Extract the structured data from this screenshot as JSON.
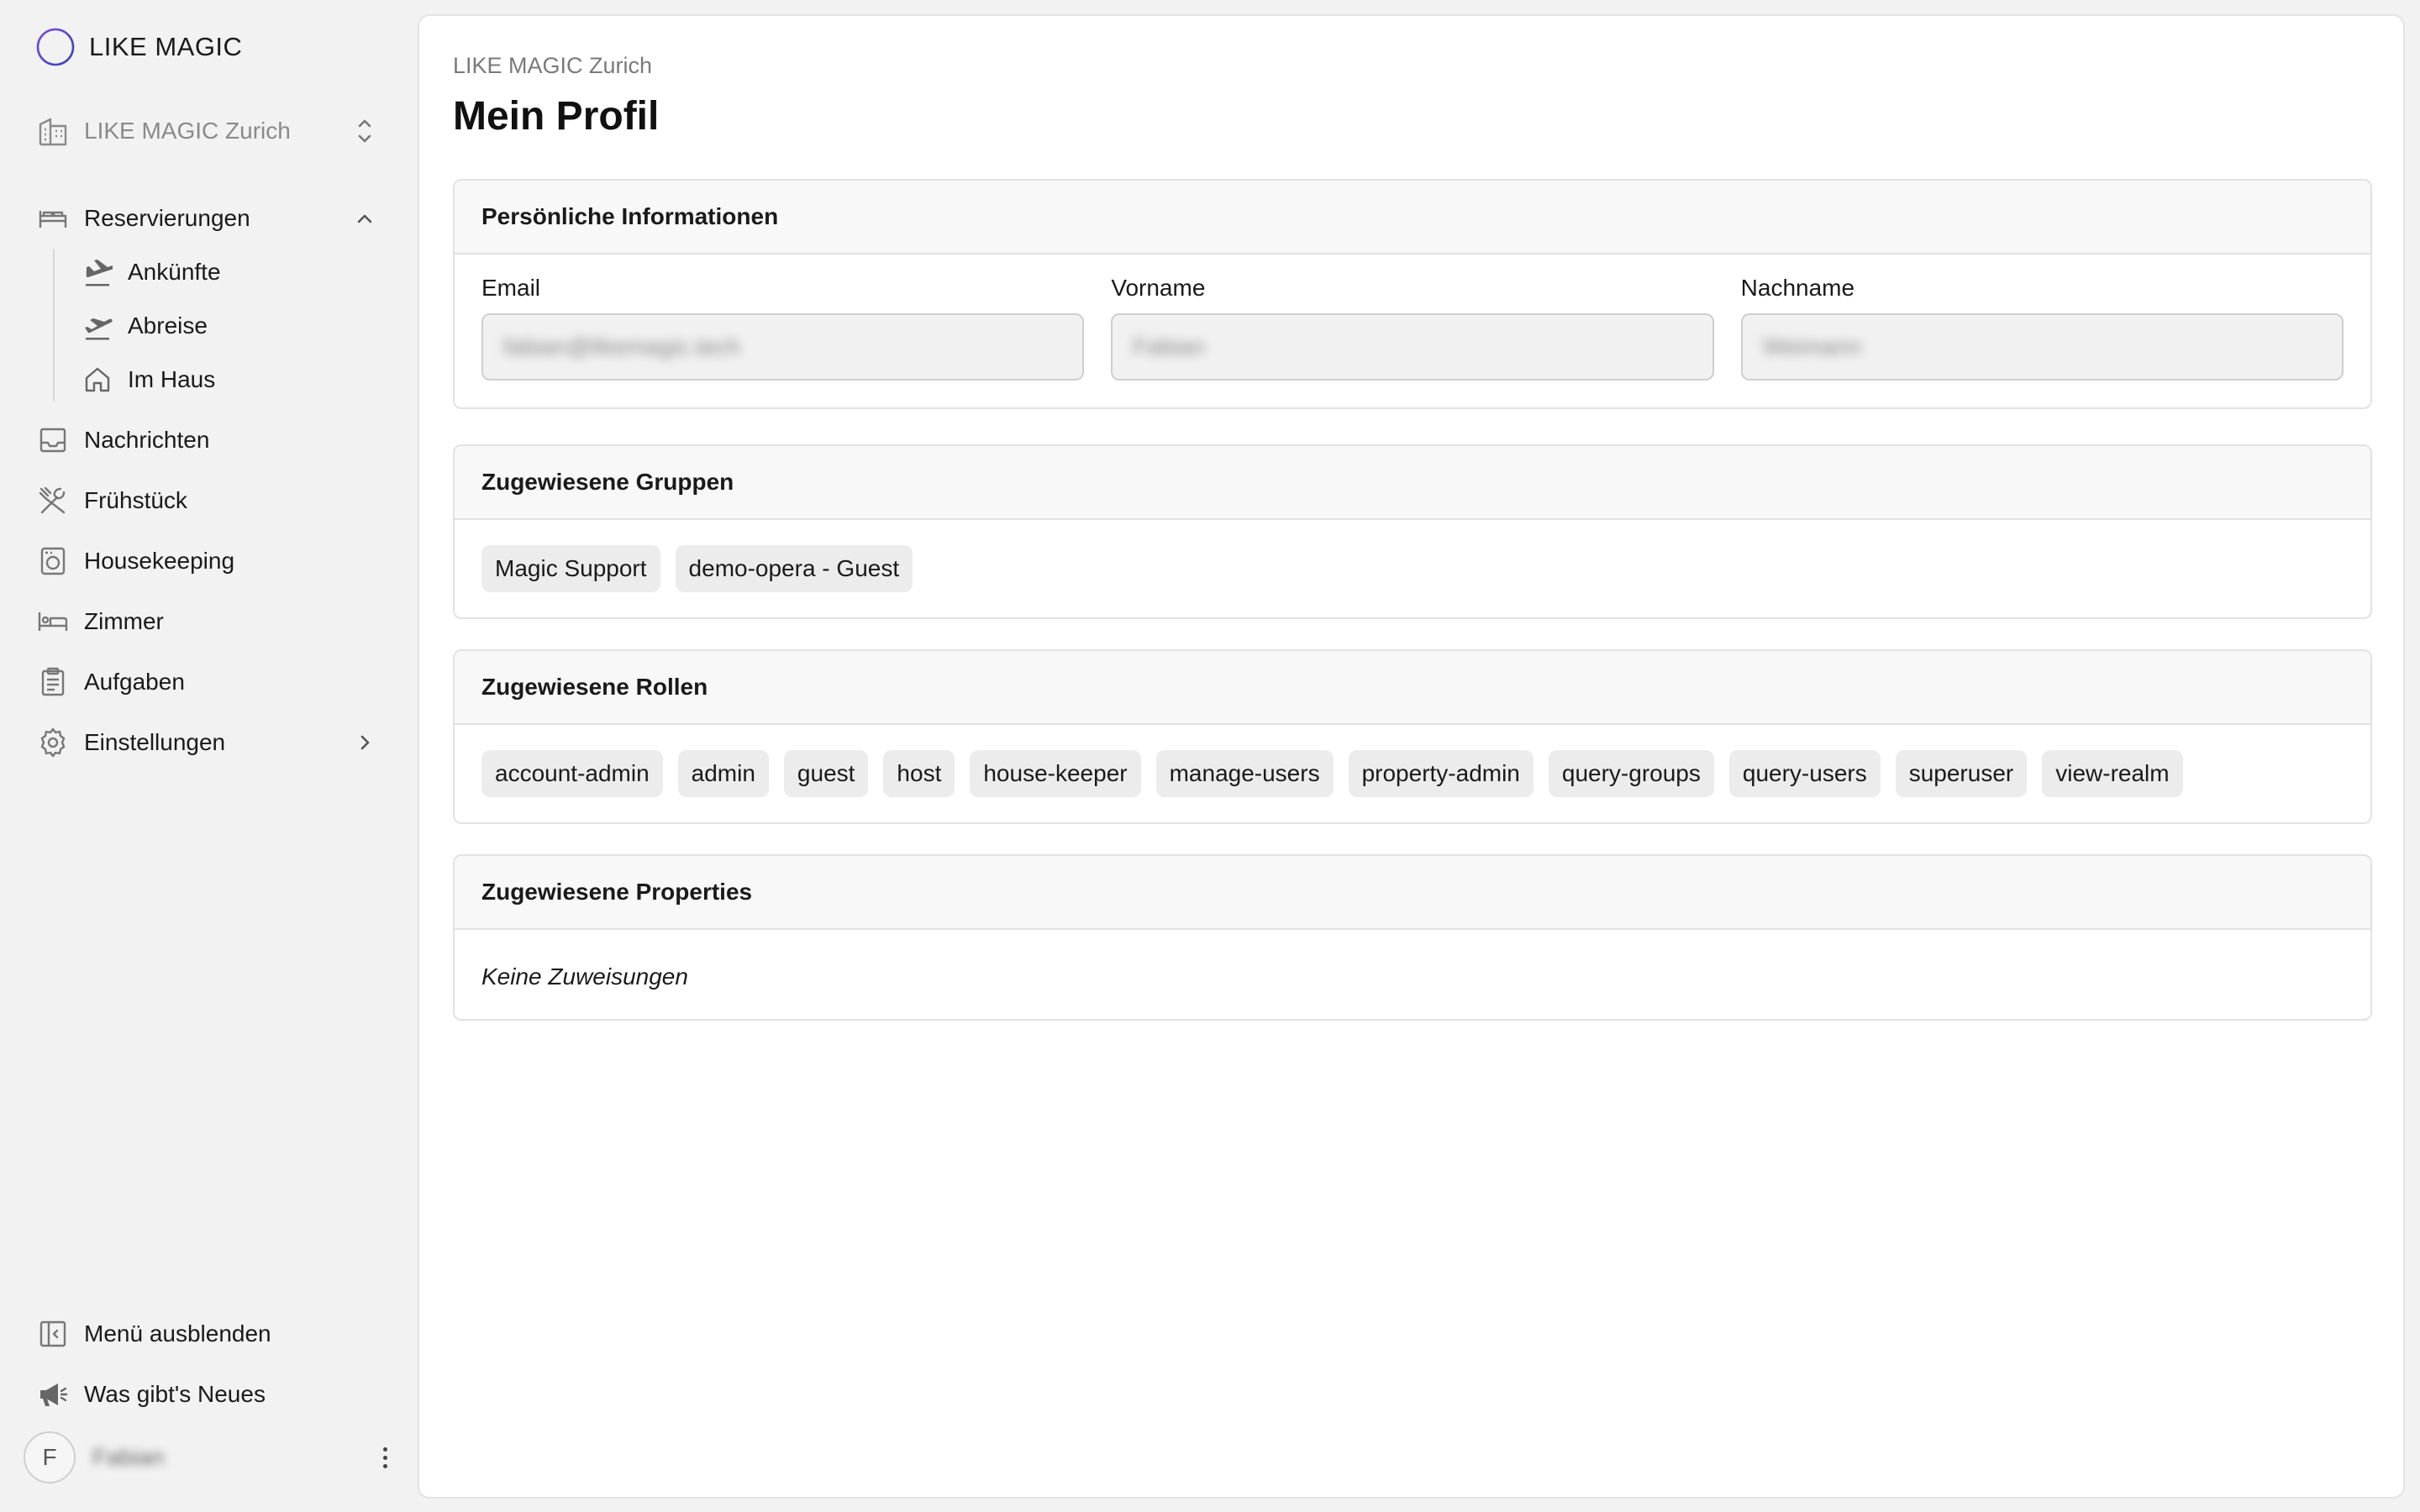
{
  "brand": {
    "name": "LIKE MAGIC",
    "logo_icon": "ring-logo-icon"
  },
  "property_switcher": {
    "label": "LIKE MAGIC Zurich",
    "icon": "building-icon"
  },
  "nav": {
    "reservierungen": {
      "label": "Reservierungen",
      "icon": "bed-icon",
      "expanded": true
    },
    "sub": {
      "ankuenfte": {
        "label": "Ankünfte",
        "icon": "plane-landing-icon"
      },
      "abreise": {
        "label": "Abreise",
        "icon": "plane-takeoff-icon"
      },
      "im_haus": {
        "label": "Im Haus",
        "icon": "home-icon"
      }
    },
    "nachrichten": {
      "label": "Nachrichten",
      "icon": "inbox-icon"
    },
    "fruehstueck": {
      "label": "Frühstück",
      "icon": "utensils-icon"
    },
    "housekeeping": {
      "label": "Housekeeping",
      "icon": "washing-machine-icon"
    },
    "zimmer": {
      "label": "Zimmer",
      "icon": "bed-single-icon"
    },
    "aufgaben": {
      "label": "Aufgaben",
      "icon": "clipboard-icon"
    },
    "einstellungen": {
      "label": "Einstellungen",
      "icon": "gear-icon"
    }
  },
  "footer": {
    "collapse": {
      "label": "Menü ausblenden",
      "icon": "panel-collapse-icon"
    },
    "news": {
      "label": "Was gibt's Neues",
      "icon": "megaphone-icon"
    },
    "user": {
      "initial": "F",
      "name": "Fabian"
    }
  },
  "page": {
    "breadcrumb": "LIKE MAGIC Zurich",
    "title": "Mein Profil"
  },
  "personal": {
    "title": "Persönliche Informationen",
    "email_label": "Email",
    "email_value": "fabian@likemagic.tech",
    "firstname_label": "Vorname",
    "firstname_value": "Fabian",
    "lastname_label": "Nachname",
    "lastname_value": "Weimann"
  },
  "groups": {
    "title": "Zugewiesene Gruppen",
    "items": [
      "Magic Support",
      "demo-opera - Guest"
    ]
  },
  "roles": {
    "title": "Zugewiesene Rollen",
    "items": [
      "account-admin",
      "admin",
      "guest",
      "host",
      "house-keeper",
      "manage-users",
      "property-admin",
      "query-groups",
      "query-users",
      "superuser",
      "view-realm"
    ]
  },
  "properties": {
    "title": "Zugewiesene Properties",
    "empty": "Keine Zuweisungen"
  },
  "colors": {
    "background": "#f2f2f2",
    "panel": "#ffffff",
    "chip": "#ececec",
    "muted": "#8a8a8a"
  }
}
